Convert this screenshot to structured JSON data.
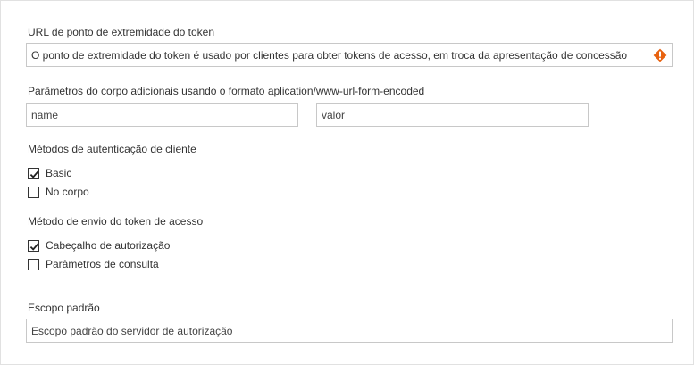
{
  "token_endpoint": {
    "label": "URL de ponto de extremidade do token",
    "value": "O ponto de extremidade do token é usado por clientes para obter tokens de acesso, em troca da apresentação de concessão",
    "warning_icon": "warning-icon",
    "warning_color": "#e8620f"
  },
  "body_params": {
    "label": "Parâmetros do corpo adicionais usando o formato aplication/www-url-form-encoded",
    "name_placeholder": "name",
    "value_placeholder": "valor"
  },
  "client_auth": {
    "label": "Métodos de autenticação de cliente",
    "options": [
      {
        "label": "Basic",
        "checked": true
      },
      {
        "label": "No corpo",
        "checked": false
      }
    ]
  },
  "token_send": {
    "label": "Método de envio do token de acesso",
    "options": [
      {
        "label": "Cabeçalho de autorização",
        "checked": true
      },
      {
        "label": "Parâmetros de consulta",
        "checked": false
      }
    ]
  },
  "default_scope": {
    "label": "Escopo padrão",
    "placeholder": "Escopo padrão do servidor de autorização"
  }
}
